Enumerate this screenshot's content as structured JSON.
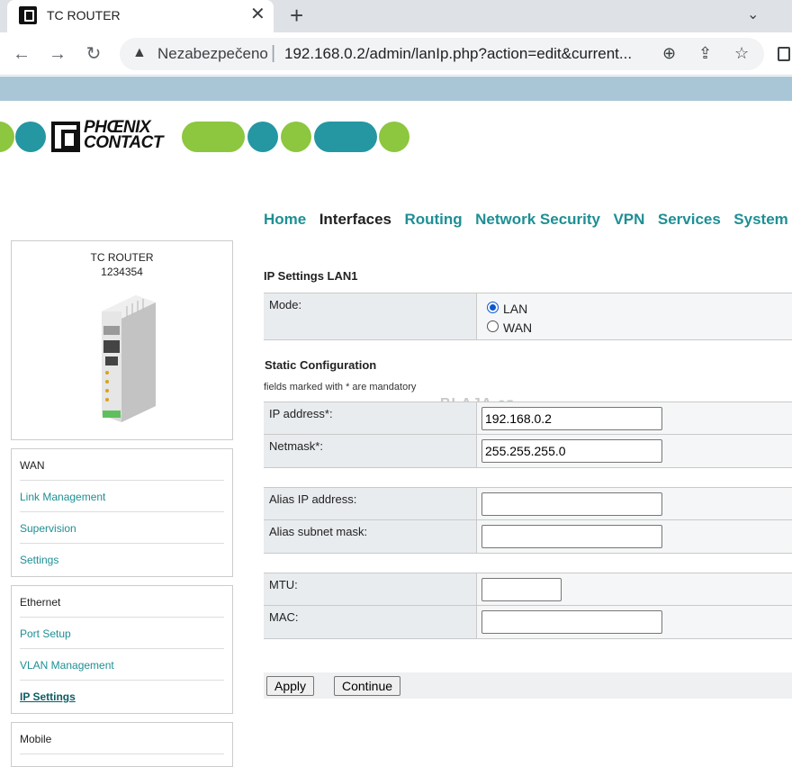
{
  "browser": {
    "tab_title": "TC ROUTER",
    "security_label": "Nezabezpečeno",
    "url": "192.168.0.2/admin/lanIp.php?action=edit&current..."
  },
  "logo": {
    "line1": "PHŒNIX",
    "line2": "CONTACT",
    "colors": {
      "green": "#8dc63f",
      "teal": "#2497a2"
    }
  },
  "topnav": [
    "Home",
    "Interfaces",
    "Routing",
    "Network Security",
    "VPN",
    "Services",
    "System"
  ],
  "topnav_active": "Interfaces",
  "device": {
    "name": "TC ROUTER",
    "serial": "1234354"
  },
  "sidebar": {
    "wan": {
      "title": "WAN",
      "items": [
        "Link Management",
        "Supervision",
        "Settings"
      ]
    },
    "ethernet": {
      "title": "Ethernet",
      "items": [
        "Port Setup",
        "VLAN Management",
        "IP Settings"
      ]
    },
    "mobile": {
      "title": "Mobile"
    }
  },
  "form": {
    "title": "IP Settings LAN1",
    "mode_label": "Mode:",
    "mode_options": [
      "LAN",
      "WAN"
    ],
    "mode_selected": "LAN",
    "static_title": "Static Configuration",
    "mandatory_note": "fields marked with * are mandatory",
    "watermark": "BLAJA.cz",
    "ip_label": "IP address*:",
    "ip_value": "192.168.0.2",
    "netmask_label": "Netmask*:",
    "netmask_value": "255.255.255.0",
    "alias_ip_label": "Alias IP address:",
    "alias_ip_value": "",
    "alias_mask_label": "Alias subnet mask:",
    "alias_mask_value": "",
    "mtu_label": "MTU:",
    "mtu_value": "",
    "mac_label": "MAC:",
    "mac_value": "",
    "apply_label": "Apply",
    "continue_label": "Continue"
  }
}
